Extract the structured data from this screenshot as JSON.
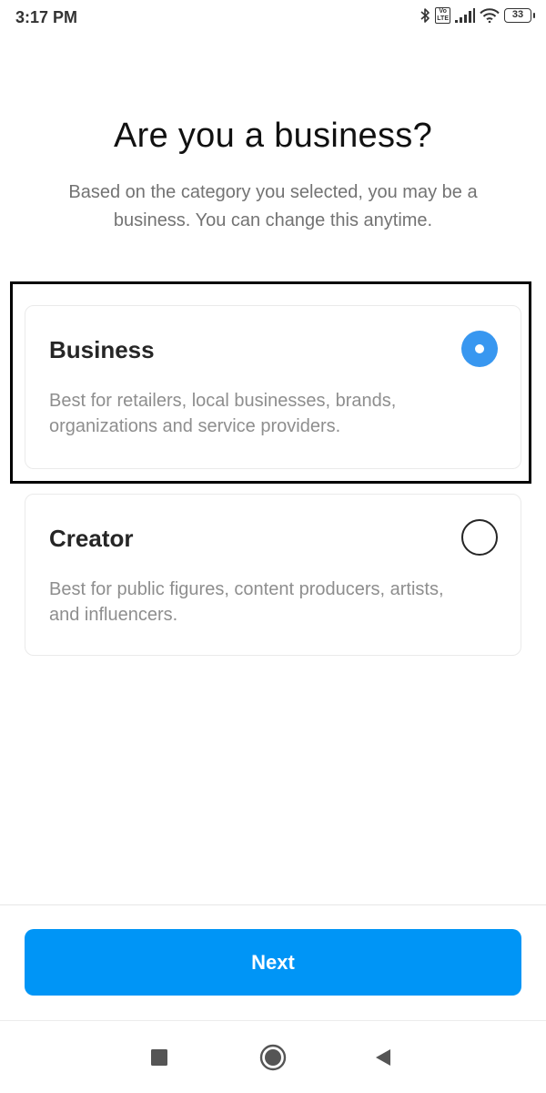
{
  "status_bar": {
    "time": "3:17 PM",
    "battery_level": "33",
    "icons": [
      "bluetooth-icon",
      "volte-icon",
      "signal-icon",
      "wifi-icon",
      "battery-icon"
    ]
  },
  "header": {
    "title": "Are you a business?",
    "subtitle": "Based on the category you selected, you may be a business. You can change this anytime."
  },
  "options": [
    {
      "title": "Business",
      "description": "Best for retailers, local businesses, brands, organizations and service providers.",
      "selected": true
    },
    {
      "title": "Creator",
      "description": "Best for public figures, content producers, artists, and influencers.",
      "selected": false
    }
  ],
  "footer": {
    "next_label": "Next"
  },
  "colors": {
    "accent": "#0095f6",
    "radio_selected": "#3897f0",
    "text_primary": "#262626",
    "text_secondary": "#8e8e8e"
  },
  "nav_bar": {
    "buttons": [
      "recents-icon",
      "home-icon",
      "back-icon"
    ]
  }
}
